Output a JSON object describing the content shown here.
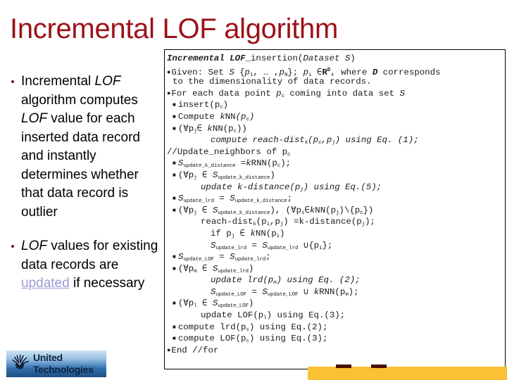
{
  "slide": {
    "title": "Incremental LOF algorithm",
    "title_color": "#9c1118"
  },
  "bullets": [
    {
      "id": "bullet-1",
      "segments": [
        {
          "text": "Incremental ",
          "style": "normal"
        },
        {
          "text": "LOF",
          "style": "italic"
        },
        {
          "text": " algorithm computes ",
          "style": "normal"
        },
        {
          "text": "LOF",
          "style": "italic"
        },
        {
          "text": " value for each inserted data record and instantly determines whether that data record is outlier",
          "style": "normal"
        }
      ],
      "plain": "Incremental LOF algorithm computes LOF value for each inserted data record and instantly determines whether that data record is outlier"
    },
    {
      "id": "bullet-2",
      "segments": [
        {
          "text": "LOF",
          "style": "italic"
        },
        {
          "text": " values for existing data records are ",
          "style": "normal"
        },
        {
          "text": "updated",
          "style": "link"
        },
        {
          "text": " if necessary",
          "style": "normal"
        }
      ],
      "plain": "LOF values for existing data records are updated if necessary",
      "link_text": "updated",
      "link_color": "#9a9ad4"
    }
  ],
  "algorithm": {
    "heading_bold_italic": "Incremental LOF",
    "heading_rest": "_insertion(Dataset S)",
    "lines": [
      {
        "n": 1,
        "kind": "heading",
        "text": "Incremental LOF_insertion(Dataset S)"
      },
      {
        "n": 2,
        "kind": "bullet1",
        "text": "Given: Set S {p1, ... ,pN}; pi ∈RD, where D corresponds"
      },
      {
        "n": 3,
        "kind": "cont",
        "text": "to the dimensionality of data records."
      },
      {
        "n": 4,
        "kind": "bullet1",
        "text": "For each data point pc coming into data set S"
      },
      {
        "n": 5,
        "kind": "bullet2",
        "text": "insert(pc)"
      },
      {
        "n": 6,
        "kind": "bullet2",
        "text": "Compute kNN(pc)"
      },
      {
        "n": 7,
        "kind": "bullet2",
        "text": "(∀pj∈ kNN(pc))"
      },
      {
        "n": 8,
        "kind": "indent",
        "text": "compute reach-distk(pc,pj) using Eq. (1);"
      },
      {
        "n": 9,
        "kind": "cont",
        "text": "//Update_neighbors of pc"
      },
      {
        "n": 10,
        "kind": "bullet2",
        "text": "Supdate_k_distance =kRNN(pc);"
      },
      {
        "n": 11,
        "kind": "bullet2",
        "text": "(∀pj ∈ Supdate_k_distance)"
      },
      {
        "n": 12,
        "kind": "indent",
        "text": "update k-distance(pj) using Eq.(5);"
      },
      {
        "n": 13,
        "kind": "bullet2",
        "text": "Supdate_lrd = Supdate_k_distance;"
      },
      {
        "n": 14,
        "kind": "bullet2",
        "text": "(∀pj ∈ Supdate_k_distance), (∀pi∈kNN(pj)\\{pc})"
      },
      {
        "n": 15,
        "kind": "indent",
        "text": "reach-distk(pi,pj) =k-distance(pj);"
      },
      {
        "n": 16,
        "kind": "indent",
        "text": "if pj ∈ kNN(pi)"
      },
      {
        "n": 17,
        "kind": "indent",
        "text": "Supdate_lrd = Supdate_lrd ∪{pi};"
      },
      {
        "n": 18,
        "kind": "bullet2",
        "text": "Supdate_LOF = Supdate_lrd;"
      },
      {
        "n": 19,
        "kind": "bullet2",
        "text": "(∀pm ∈ Supdate_lrd)"
      },
      {
        "n": 20,
        "kind": "indent",
        "text": "update lrd(pm) using Eq. (2);"
      },
      {
        "n": 21,
        "kind": "indent",
        "text": "Supdate_LOF = Supdate_LOF ∪ kRNN(pm);"
      },
      {
        "n": 22,
        "kind": "bullet2",
        "text": "(∀pl ∈ Supdate_LOF)"
      },
      {
        "n": 23,
        "kind": "indent",
        "text": "update LOF(pl) using Eq.(3);"
      },
      {
        "n": 24,
        "kind": "bullet2",
        "text": "compute lrd(pc) using Eq.(2);"
      },
      {
        "n": 25,
        "kind": "bullet2",
        "text": "compute LOF(pc) using Eq.(3);"
      },
      {
        "n": 26,
        "kind": "bullet1",
        "text": "End //for"
      }
    ]
  },
  "logo": {
    "line1": "United",
    "line2": "Technologies",
    "mark": "starburst-icon",
    "text_color": "#10243f"
  },
  "accent_bar": {
    "color": "#fbc135"
  }
}
